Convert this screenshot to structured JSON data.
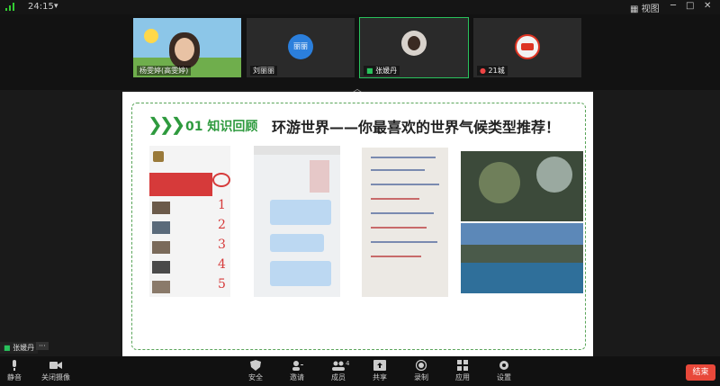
{
  "status": {
    "time": "24:15",
    "view_label": "视图"
  },
  "participants": [
    {
      "name": "杨雯婷(高雯婷)"
    },
    {
      "name": "刘丽丽",
      "initials": "丽丽"
    },
    {
      "name": "张媛丹",
      "active": true
    },
    {
      "name": "21城"
    }
  ],
  "slide": {
    "badge": "01 知识回顾",
    "title": "环游世界——你最喜欢的世界气候类型推荐！",
    "handwritten_numbers": [
      "1",
      "2",
      "3",
      "4",
      "5"
    ]
  },
  "self_view": {
    "name": "张媛丹",
    "more": "···"
  },
  "toolbar": [
    {
      "label": "静音",
      "icon": "mic-icon"
    },
    {
      "label": "关闭摄像",
      "icon": "camera-icon"
    },
    {
      "label": "安全",
      "icon": "shield-icon"
    },
    {
      "label": "邀请",
      "icon": "invite-icon"
    },
    {
      "label": "成员",
      "icon": "members-icon",
      "count": "4"
    },
    {
      "label": "共享",
      "icon": "share-icon"
    },
    {
      "label": "录制",
      "icon": "record-icon"
    },
    {
      "label": "应用",
      "icon": "apps-icon"
    },
    {
      "label": "设置",
      "icon": "gear-icon"
    }
  ],
  "end_label": "结束",
  "colors": {
    "accent_green": "#2e9a3e",
    "end_red": "#e8483a",
    "active_outline": "#29c15c"
  }
}
